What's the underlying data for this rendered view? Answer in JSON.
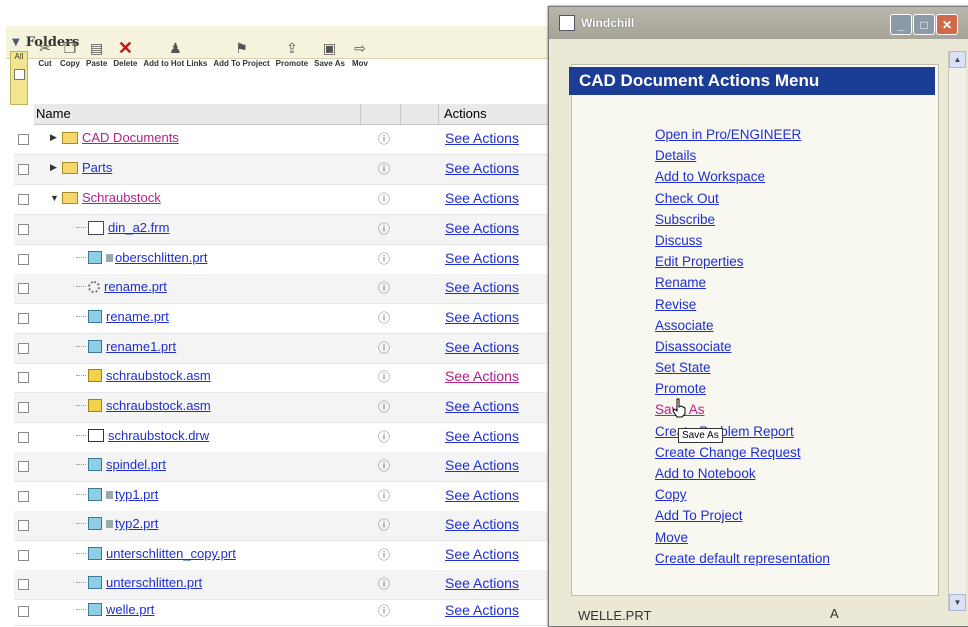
{
  "folders": {
    "header": "Folders",
    "all_label": "All",
    "toolbar": [
      {
        "label": "Cut",
        "icon": "scissors-icon"
      },
      {
        "label": "Copy",
        "icon": "copy-icon"
      },
      {
        "label": "Paste",
        "icon": "paste-icon"
      },
      {
        "label": "Delete",
        "icon": "delete-x-icon"
      },
      {
        "label": "Add to Hot Links",
        "icon": "hot-links-icon"
      },
      {
        "label": "Add To Project",
        "icon": "project-icon"
      },
      {
        "label": "Promote",
        "icon": "promote-icon"
      },
      {
        "label": "Save As",
        "icon": "save-as-icon"
      },
      {
        "label": "Mov",
        "icon": "move-icon"
      }
    ],
    "columns": {
      "name": "Name",
      "actions": "Actions"
    },
    "info_glyph": "ⓘ",
    "rows": [
      {
        "name": "CAD Documents",
        "icon": "folder-icon",
        "action": "See Actions"
      },
      {
        "name": "Parts",
        "icon": "folder-icon",
        "action": "See Actions"
      },
      {
        "name": "Schraubstock",
        "icon": "folder-icon",
        "action": "See Actions"
      },
      {
        "name": "din_a2.frm",
        "icon": "format-icon",
        "action": "See Actions"
      },
      {
        "name": "oberschlitten.prt",
        "icon": "part-icon",
        "action": "See Actions"
      },
      {
        "name": "rename.prt",
        "icon": "gear-icon",
        "action": "See Actions"
      },
      {
        "name": "rename.prt",
        "icon": "part-icon",
        "action": "See Actions"
      },
      {
        "name": "rename1.prt",
        "icon": "part-icon",
        "action": "See Actions"
      },
      {
        "name": "schraubstock.asm",
        "icon": "assembly-icon",
        "action": "See Actions"
      },
      {
        "name": "schraubstock.asm",
        "icon": "assembly-icon",
        "action": "See Actions"
      },
      {
        "name": "schraubstock.drw",
        "icon": "drawing-icon",
        "action": "See Actions"
      },
      {
        "name": "spindel.prt",
        "icon": "part-icon",
        "action": "See Actions"
      },
      {
        "name": "typ1.prt",
        "icon": "part-icon",
        "action": "See Actions"
      },
      {
        "name": "typ2.prt",
        "icon": "part-icon",
        "action": "See Actions"
      },
      {
        "name": "unterschlitten_copy.prt",
        "icon": "part-icon",
        "action": "See Actions"
      },
      {
        "name": "unterschlitten.prt",
        "icon": "part-icon",
        "action": "See Actions"
      },
      {
        "name": "welle.prt",
        "icon": "part-icon",
        "action": "See Actions"
      }
    ]
  },
  "popup": {
    "title": "Windchill",
    "menu_title": "CAD Document Actions Menu",
    "items": [
      "Open in Pro/ENGINEER",
      "Details",
      "Add to Workspace",
      "Check Out",
      "Subscribe",
      "Discuss",
      "Edit Properties",
      "Rename",
      "Revise",
      "Associate",
      "Disassociate",
      "Set State",
      "Promote",
      "Save As",
      "Create Problem Report",
      "Create Change Request",
      "Add to Notebook",
      "Copy",
      "Add To Project",
      "Move",
      "Create default representation"
    ],
    "tooltip": "Save As",
    "under_text": "WELLE.PRT",
    "under_mark": "A"
  },
  "colors": {
    "link": "#1f2fd0",
    "visited_link": "#b0208a",
    "menu_title_bg": "#1c3d96",
    "folder_header_bg": "#f5f3dc"
  }
}
